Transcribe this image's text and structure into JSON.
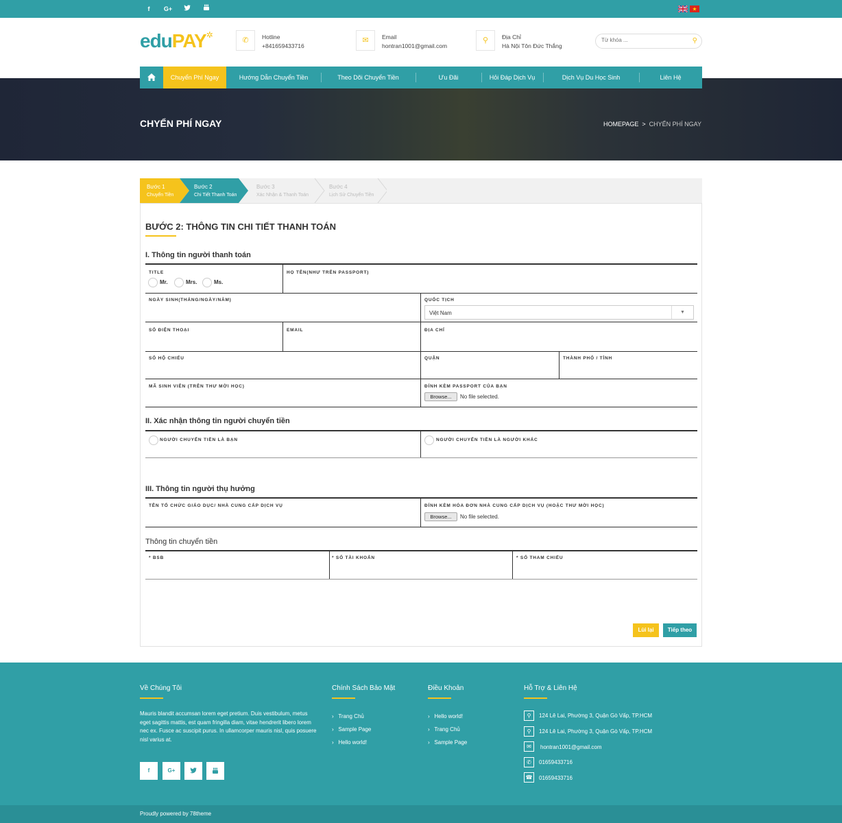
{
  "topbar": {
    "social": [
      "f",
      "G+",
      "t",
      "yt"
    ],
    "languages": [
      "English",
      "Vietnamese"
    ]
  },
  "header": {
    "logo_part1": "edu",
    "logo_part2": "PAY",
    "hotline_label": "Hotline",
    "hotline_value": "+841659433716",
    "email_label": "Email",
    "email_value": "hontran1001@gmail.com",
    "address_label": "Địa Chỉ",
    "address_value": "Hà Nội Tôn Đức Thắng",
    "search_placeholder": "Từ khóa ..."
  },
  "nav": {
    "items": [
      "Chuyển Phí Ngay",
      "Hướng Dẫn Chuyển Tiền",
      "Theo Dõi Chuyển Tiền",
      "Ưu Đãi",
      "Hỏi Đáp Dịch Vụ",
      "Dịch Vụ Du Học Sinh",
      "Liên Hệ"
    ]
  },
  "hero": {
    "title": "CHYỂN PHÍ NGAY",
    "breadcrumb_home": "HOMEPAGE",
    "breadcrumb_sep": ">",
    "breadcrumb_current": "CHYỂN PHÍ NGAY"
  },
  "steps": [
    {
      "title": "Bước 1",
      "sub": "Chuyển Tiền"
    },
    {
      "title": "Bước 2",
      "sub": "Chi Tiết Thanh Toán"
    },
    {
      "title": "Bước 3",
      "sub": "Xác Nhận & Thanh Toán"
    },
    {
      "title": "Bước 4",
      "sub": "Lịch Sử Chuyển Tiền"
    }
  ],
  "form": {
    "title": "BƯỚC 2: THÔNG TIN CHI TIẾT THANH TOÁN",
    "section1": "I. Thông tin người thanh toán",
    "title_label": "TITLE",
    "title_options": [
      "Mr.",
      "Mrs.",
      "Ms."
    ],
    "fullname_label": "HỌ TÊN(NHƯ TRÊN PASSPORT)",
    "dob_label": "NGÀY SINH(THÁNG/NGÀY/NĂM)",
    "nationality_label": "QUỐC TỊCH",
    "nationality_value": "Việt Nam",
    "phone_label": "SỐ ĐIỆN THOẠI",
    "email_label": "EMAIL",
    "address_label": "ĐỊA CHỈ",
    "passport_label": "SỐ HỘ CHIẾU",
    "district_label": "QUẬN",
    "city_label": "THÀNH PHỐ / TỈNH",
    "student_id_label": "MÃ SINH VIÊN (TRÊN THƯ MỜI HỌC)",
    "attach_passport_label": "ĐÍNH KÈM PASSPORT CỦA BẠN",
    "browse_label": "Browse...",
    "no_file": "No file selected.",
    "section2": "II. Xác nhận thông tin người chuyển tiền",
    "sender_self": "NGƯỜI CHUYỂN TIỀN LÀ BẠN",
    "sender_other": "NGƯỜI CHUYỂN TIỀN LÀ NGƯỜI KHÁC",
    "section3": "III. Thông tin người thụ hưởng",
    "org_label": "TÊN TỔ CHỨC GIÁO DỤC/ NHÀ CUNG CẤP DỊCH VỤ",
    "attach_invoice_label": "ĐÍNH KÈM HÓA ĐƠN NHÀ CUNG CẤP DỊCH VỤ (HOẶC THƯ MỜI HỌC)",
    "transfer_info": "Thông tin chuyển tiền",
    "bsb_label": "* BSB",
    "account_label": "* SỐ TÀI KHOẢN",
    "reference_label": "* SỐ THAM CHIẾU",
    "back_button": "Lùi lại",
    "next_button": "Tiếp theo"
  },
  "footer": {
    "about_title": "Về Chúng Tôi",
    "about_text": "Mauris blandit accumsan lorem eget pretium. Duis vestibulum, metus eget sagittis mattis, est quam fringilla diam, vitae hendrerit libero lorem nec ex. Fusce ac suscipit purus. In ullamcorper mauris nisl, quis posuere nisl varius at.",
    "social": [
      "f",
      "G+",
      "t",
      "yt"
    ],
    "policy_title": "Chính Sách Bảo Mật",
    "policy_links": [
      "Trang Chủ",
      "Sample Page",
      "Hello world!"
    ],
    "terms_title": "Điều Khoản",
    "terms_links": [
      "Hello world!",
      "Trang Chủ",
      "Sample Page"
    ],
    "support_title": "Hỗ Trợ & Liên Hệ",
    "contacts": [
      "124 Lê Lai, Phường 3, Quận Gò Vấp, TP.HCM",
      "124 Lê Lai, Phường 3, Quận Gò Vấp, TP.HCM",
      "hontran1001@gmail.com",
      "01659433716",
      "01659433716"
    ],
    "copyright": "Proudly powered by 78theme"
  },
  "colors": {
    "teal": "#309fa6",
    "yellow": "#f5c31c",
    "dark": "#333333"
  }
}
